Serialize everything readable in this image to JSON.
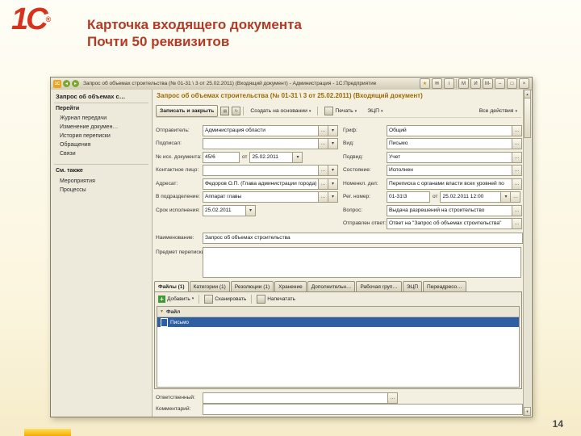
{
  "icons": {
    "ellipsis": "…",
    "dropdown": "▾",
    "up_arrow": "▲",
    "down_arrow": "▼",
    "back": "◂",
    "forward": "▸",
    "star": "★",
    "mail": "✉",
    "info": "i",
    "minimize": "‒",
    "maximize": "□",
    "close": "×",
    "plus": "+",
    "filter": "▼",
    "app": "1С",
    "doc": "▤",
    "refresh": "↻"
  },
  "slide": {
    "logo_text": "1С",
    "logo_reg": "®",
    "title_line1": "Карточка входящего документа",
    "title_line2": "Почти 50 реквизитов",
    "page_number": "14"
  },
  "window": {
    "title": "Запрос об объемах строительства (№ 01-31 \\ 3 от 25.02.2011) (Входящий документ) - Администрация - 1С:Предприятие",
    "menu_buttons": [
      "М",
      "И",
      "М-"
    ]
  },
  "sidebar": {
    "header": "Запрос об объемах с…",
    "group1_title": "Перейти",
    "group1_items": [
      "Журнал передачи",
      "Изменение докумен…",
      "История переписки",
      "Обращения",
      "Связи"
    ],
    "group2_title": "См. также",
    "group2_items": [
      "Мероприятия",
      "Процессы"
    ]
  },
  "main": {
    "header": "Запрос об объемах строительства (№ 01-31 \\ 3 от 25.02.2011) (Входящий документ)",
    "toolbar": {
      "save_close": "Записать и закрыть",
      "create_based_on": "Создать на основании",
      "print": "Печать",
      "signature": "ЭЦП",
      "all_actions": "Все действия"
    },
    "form": {
      "left": [
        {
          "label": "Отправитель:",
          "value": "Администрация области"
        },
        {
          "label": "Подписал:",
          "value": ""
        },
        {
          "label": "№ исх. документа:",
          "value": "45/6",
          "from_label": "от",
          "date": "25.02.2011"
        },
        {
          "label": "Контактное лицо:",
          "value": ""
        },
        {
          "label": "Адресат:",
          "value": "Федоров О.П. (Глава администрации города)"
        },
        {
          "label": "В подразделение:",
          "value": "Аппарат главы"
        },
        {
          "label": "Срок исполнения:",
          "value": "25.02.2011"
        }
      ],
      "right": [
        {
          "label": "Гриф:",
          "value": "Общий"
        },
        {
          "label": "Вид:",
          "value": "Письмо"
        },
        {
          "label": "Подвид:",
          "value": "Учет"
        },
        {
          "label": "Состояние:",
          "value": "Исполнен"
        },
        {
          "label": "Номенкл. дел:",
          "value": "Переписка с органами власти всех уровней по"
        },
        {
          "label": "Рег. номер:",
          "value": "01-31\\3",
          "from_label": "от",
          "date": "25.02.2011 12:00"
        },
        {
          "label": "Вопрос:",
          "value": "Выдача разрешений на строительство"
        },
        {
          "label": "Отправлен ответ:",
          "value": "Ответ на \"Запрос об объемах строительства\""
        }
      ],
      "name": {
        "label": "Наименование:",
        "value": "Запрос об объемах строительства"
      },
      "subject": {
        "label": "Предмет переписки:",
        "value": ""
      },
      "responsible": {
        "label": "Ответственный:",
        "value": ""
      },
      "comment": {
        "label": "Комментарий:",
        "value": ""
      }
    },
    "tabs": [
      "Файлы (1)",
      "Категории (1)",
      "Резолюции (1)",
      "Хранение",
      "Дополнительн…",
      "Рабочая груп…",
      "ЭЦП",
      "Переадресо…"
    ],
    "files": {
      "add": "Добавить",
      "scan": "Сканировать",
      "print": "Напечатать",
      "column": "Файл",
      "rows": [
        "Письмо"
      ]
    }
  }
}
